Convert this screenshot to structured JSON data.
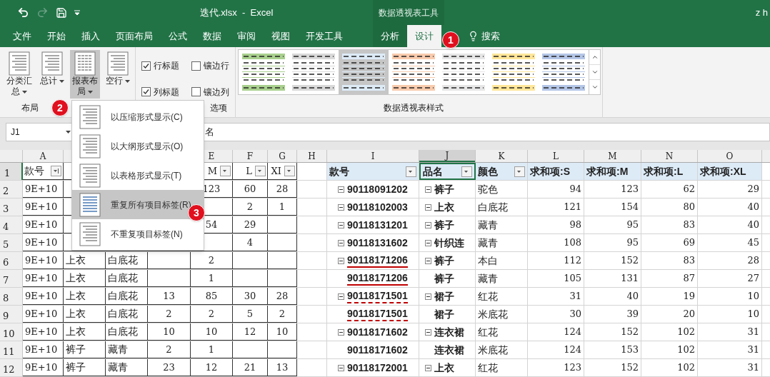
{
  "title_bar": {
    "file_title": "迭代.xlsx  -  Excel",
    "context_label": "数据透视表工具",
    "user": "z h"
  },
  "tabs": [
    {
      "label": "文件",
      "selected": false,
      "kind": "plain"
    },
    {
      "label": "开始",
      "selected": false,
      "kind": "plain"
    },
    {
      "label": "插入",
      "selected": false,
      "kind": "plain"
    },
    {
      "label": "页面布局",
      "selected": false,
      "kind": "plain"
    },
    {
      "label": "公式",
      "selected": false,
      "kind": "plain"
    },
    {
      "label": "数据",
      "selected": false,
      "kind": "plain"
    },
    {
      "label": "审阅",
      "selected": false,
      "kind": "plain"
    },
    {
      "label": "视图",
      "selected": false,
      "kind": "plain"
    },
    {
      "label": "开发工具",
      "selected": false,
      "kind": "plain"
    },
    {
      "label": "分析",
      "selected": false,
      "kind": "context"
    },
    {
      "label": "设计",
      "selected": true,
      "kind": "context"
    },
    {
      "label": "搜索",
      "selected": false,
      "kind": "search"
    }
  ],
  "ribbon": {
    "layout_group": {
      "label": "布局",
      "buttons": [
        {
          "label": "分类汇总",
          "pressed": false
        },
        {
          "label": "总计",
          "pressed": false
        },
        {
          "label": "报表布局",
          "pressed": true
        },
        {
          "label": "空行",
          "pressed": false
        }
      ]
    },
    "options_group": {
      "label": "选项",
      "checks": [
        {
          "label": "行标题",
          "checked": true
        },
        {
          "label": "镶边行",
          "checked": false
        },
        {
          "label": "列标题",
          "checked": true
        },
        {
          "label": "镶边列",
          "checked": false
        }
      ]
    },
    "styles_group": {
      "label": "数据透视表样式",
      "styles": [
        {
          "color": "#a9d08e",
          "selected": false
        },
        {
          "color": "#d9d9d9",
          "selected": false
        },
        {
          "color": "#ddebf7",
          "selected": true
        },
        {
          "color": "#f8cbad",
          "selected": false
        },
        {
          "color": "#e7e6e6",
          "selected": false
        },
        {
          "color": "#ffe699",
          "selected": false
        },
        {
          "color": "#b4c6e7",
          "selected": false
        }
      ]
    }
  },
  "formula_bar": {
    "name_box": "J1",
    "formula": "名"
  },
  "layout_menu": {
    "items": [
      {
        "label": "以压缩形式显示(C)",
        "selected": false
      },
      {
        "label": "以大纲形式显示(O)",
        "selected": false
      },
      {
        "label": "以表格形式显示(T)",
        "selected": false
      },
      {
        "label": "重复所有项目标签(R)",
        "selected": true
      },
      {
        "label": "不重复项目标签(N)",
        "selected": false
      }
    ]
  },
  "callouts": [
    {
      "text": "1"
    },
    {
      "text": "2"
    },
    {
      "text": "3"
    }
  ],
  "sheet": {
    "columns": {
      "a": {
        "label": "A",
        "selected": false
      },
      "e": {
        "label": "E",
        "selected": false
      },
      "f": {
        "label": "F",
        "selected": false
      },
      "g": {
        "label": "G",
        "selected": false
      },
      "h": {
        "label": "H",
        "selected": false
      },
      "i": {
        "label": "I",
        "selected": false
      },
      "j": {
        "label": "J",
        "selected": true
      },
      "k": {
        "label": "K",
        "selected": false
      },
      "l": {
        "label": "L",
        "selected": false
      },
      "m": {
        "label": "M",
        "selected": false
      },
      "n": {
        "label": "N",
        "selected": false
      },
      "o": {
        "label": "O",
        "selected": false
      }
    },
    "header_row": {
      "row": "1",
      "left": {
        "a": {
          "text": "款号",
          "sorted": true
        },
        "e": {
          "text": "M",
          "sorted": false
        },
        "f": {
          "text": "L",
          "sorted": false
        },
        "g": {
          "text": "XI",
          "sorted": false
        }
      },
      "pivot": [
        {
          "text": "款号",
          "filter": true,
          "selected": false
        },
        {
          "text": "品名",
          "filter": true,
          "selected": true
        },
        {
          "text": "颜色",
          "filter": true,
          "selected": false
        },
        {
          "text": "求和项:S",
          "filter": false,
          "selected": false
        },
        {
          "text": "求和项:M",
          "filter": false,
          "selected": false
        },
        {
          "text": "求和项:L",
          "filter": false,
          "selected": false
        },
        {
          "text": "求和项:XL",
          "filter": false,
          "selected": false
        }
      ]
    },
    "rows": [
      {
        "row": "2",
        "left": {
          "a": "9E+10",
          "e": "123",
          "f": "60",
          "g": "28"
        },
        "id": "90118091202",
        "name": "裤子",
        "shade": "驼色",
        "values": [
          "94",
          "123",
          "62",
          "29"
        ],
        "collapsible": true,
        "kind": "plain"
      },
      {
        "row": "3",
        "left": {
          "a": "9E+10",
          "f": "2",
          "g": "1"
        },
        "id": "90118102003",
        "name": "上衣",
        "shade": "白底花",
        "values": [
          "121",
          "154",
          "80",
          "40"
        ],
        "collapsible": true,
        "kind": "plain"
      },
      {
        "row": "4",
        "left": {
          "a": "9E+10",
          "e": "54",
          "f": "29"
        },
        "id": "90118131201",
        "name": "裤子",
        "shade": "藏青",
        "values": [
          "98",
          "95",
          "83",
          "40"
        ],
        "collapsible": true,
        "kind": "plain"
      },
      {
        "row": "5",
        "left": {
          "a": "9E+10",
          "f": "4"
        },
        "id": "90118131602",
        "name": "针织连",
        "shade": "藏青",
        "values": [
          "108",
          "95",
          "69",
          "45"
        ],
        "collapsible": true,
        "kind": "plain"
      },
      {
        "row": "6",
        "left": {
          "a": "9E+10",
          "b": "上衣",
          "c": "白底花",
          "e": "2"
        },
        "id": "90118171206",
        "name": "裤子",
        "shade": "本白",
        "values": [
          "112",
          "152",
          "83",
          "28"
        ],
        "collapsible": true,
        "kind": "solid_underline"
      },
      {
        "row": "7",
        "left": {
          "a": "9E+10",
          "b": "上衣",
          "c": "白底花",
          "e": "1"
        },
        "id": "90118171206",
        "name": "裤子",
        "shade": "藏青",
        "values": [
          "105",
          "131",
          "87",
          "27"
        ],
        "collapsible": false,
        "kind": "solid_underline"
      },
      {
        "row": "8",
        "left": {
          "a": "9E+10",
          "b": "上衣",
          "c": "白底花",
          "d": "13",
          "e": "85",
          "f": "30",
          "g": "28"
        },
        "id": "90118171501",
        "name": "裙子",
        "shade": "红花",
        "values": [
          "31",
          "40",
          "19",
          "10"
        ],
        "collapsible": true,
        "kind": "dashed_underline"
      },
      {
        "row": "9",
        "left": {
          "a": "9E+10",
          "b": "上衣",
          "c": "白底花",
          "d": "2",
          "e": "2",
          "f": "5",
          "g": "2"
        },
        "id": "90118171501",
        "name": "裙子",
        "shade": "米底花",
        "values": [
          "30",
          "39",
          "20",
          "10"
        ],
        "collapsible": false,
        "kind": "dashed_underline"
      },
      {
        "row": "10",
        "left": {
          "a": "9E+10",
          "b": "上衣",
          "c": "白底花",
          "d": "10",
          "e": "10",
          "f": "12",
          "g": "10"
        },
        "id": "90118171602",
        "name": "连衣裙",
        "shade": "红花",
        "values": [
          "124",
          "152",
          "102",
          "31"
        ],
        "collapsible": true,
        "kind": "plain"
      },
      {
        "row": "11",
        "left": {
          "a": "9E+10",
          "b": "裤子",
          "c": "藏青",
          "d": "2",
          "e": "1"
        },
        "id": "90118171602",
        "name": "连衣裙",
        "shade": "米底花",
        "values": [
          "124",
          "153",
          "102",
          "31"
        ],
        "collapsible": false,
        "kind": "plain"
      },
      {
        "row": "12",
        "left": {
          "a": "9E+10",
          "b": "裤子",
          "c": "藏青",
          "d": "23",
          "e": "12",
          "f": "21",
          "g": "13"
        },
        "id": "90118172001",
        "name": "上衣",
        "shade": "红花",
        "values": [
          "123",
          "152",
          "102",
          "31"
        ],
        "collapsible": true,
        "kind": "plain"
      }
    ]
  }
}
